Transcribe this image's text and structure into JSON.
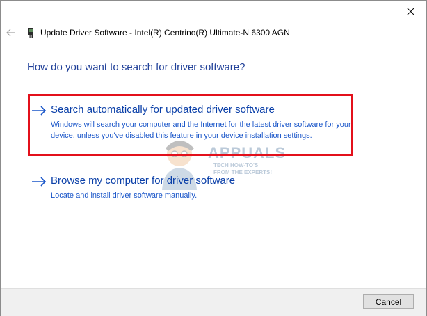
{
  "window": {
    "title": "Update Driver Software - Intel(R) Centrino(R) Ultimate-N 6300 AGN",
    "icons": {
      "close": "close-icon",
      "back": "back-arrow-icon",
      "device": "network-adapter-icon"
    }
  },
  "main": {
    "question": "How do you want to search for driver software?",
    "options": [
      {
        "title": "Search automatically for updated driver software",
        "description": "Windows will search your computer and the Internet for the latest driver software for your device, unless you've disabled this feature in your device installation settings.",
        "icon": "arrow-right-icon"
      },
      {
        "title": "Browse my computer for driver software",
        "description": "Locate and install driver software manually.",
        "icon": "arrow-right-icon"
      }
    ]
  },
  "watermark": {
    "text": "APPUALS",
    "subtitle": "TECH HOW-TO'S FROM THE EXPERTS!"
  },
  "footer": {
    "cancel_label": "Cancel"
  },
  "colors": {
    "highlight": "#e3101b",
    "link_title": "#0a3fa8",
    "link_desc": "#1a56c9",
    "heading": "#1f3f98"
  }
}
